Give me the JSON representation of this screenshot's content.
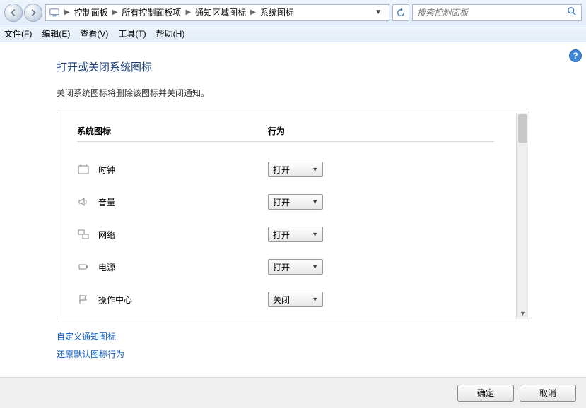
{
  "breadcrumbs": {
    "item0": "控制面板",
    "item1": "所有控制面板项",
    "item2": "通知区域图标",
    "item3": "系统图标"
  },
  "search": {
    "placeholder": "搜索控制面板"
  },
  "menu": {
    "file": "文件(F)",
    "edit": "编辑(E)",
    "view": "查看(V)",
    "tools": "工具(T)",
    "help": "帮助(H)"
  },
  "page": {
    "title": "打开或关闭系统图标",
    "subtitle": "关闭系统图标将删除该图标并关闭通知。",
    "col_left": "系统图标",
    "col_right": "行为"
  },
  "rows": {
    "r0": {
      "label": "时钟",
      "value": "打开"
    },
    "r1": {
      "label": "音量",
      "value": "打开"
    },
    "r2": {
      "label": "网络",
      "value": "打开"
    },
    "r3": {
      "label": "电源",
      "value": "打开"
    },
    "r4": {
      "label": "操作中心",
      "value": "关闭"
    }
  },
  "links": {
    "customize": "自定义通知图标",
    "restore": "还原默认图标行为"
  },
  "footer": {
    "ok": "确定",
    "cancel": "取消"
  }
}
